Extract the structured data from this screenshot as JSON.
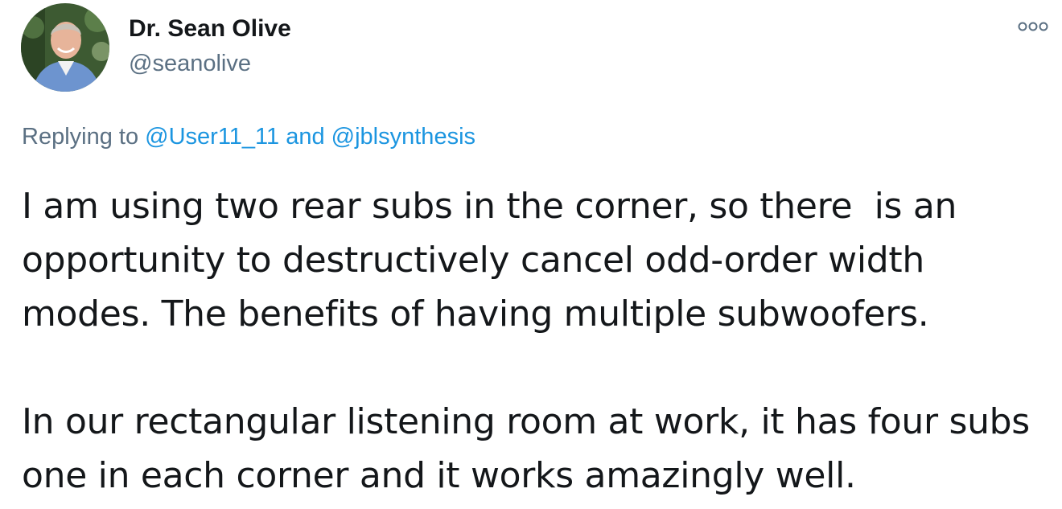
{
  "author": {
    "display_name": "Dr. Sean Olive",
    "handle": "@seanolive"
  },
  "more_icon": "more-horizontal-icon",
  "reply_context": {
    "prefix": "Replying to ",
    "mention_1": "@User11_11",
    "joiner": " and ",
    "mention_2": "@jblsynthesis"
  },
  "tweet_body": {
    "paragraph_1": "I am using two rear subs in the corner, so there  is an opportunity to destructively cancel odd-order width modes. The benefits of having multiple subwoofers.",
    "paragraph_2": "In our rectangular listening room at work, it has four subs one in each corner and it works amazingly well."
  },
  "colors": {
    "text": "#14171a",
    "secondary": "#5b7083",
    "link": "#1b95e0"
  }
}
